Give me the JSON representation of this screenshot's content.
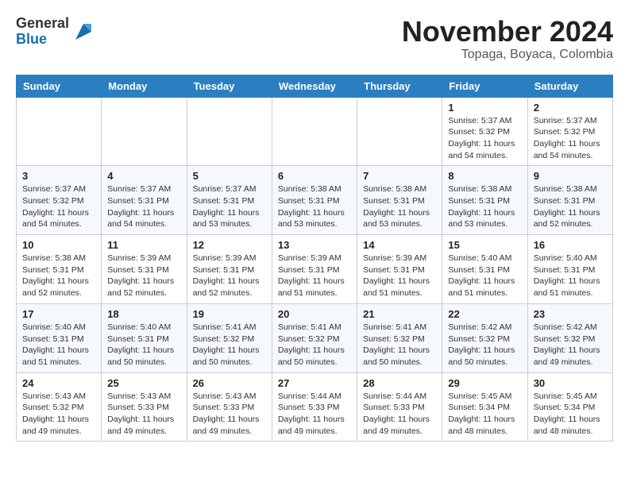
{
  "logo": {
    "general": "General",
    "blue": "Blue"
  },
  "header": {
    "title": "November 2024",
    "subtitle": "Topaga, Boyaca, Colombia"
  },
  "days_of_week": [
    "Sunday",
    "Monday",
    "Tuesday",
    "Wednesday",
    "Thursday",
    "Friday",
    "Saturday"
  ],
  "weeks": [
    [
      {
        "day": "",
        "sunrise": "",
        "sunset": "",
        "daylight": ""
      },
      {
        "day": "",
        "sunrise": "",
        "sunset": "",
        "daylight": ""
      },
      {
        "day": "",
        "sunrise": "",
        "sunset": "",
        "daylight": ""
      },
      {
        "day": "",
        "sunrise": "",
        "sunset": "",
        "daylight": ""
      },
      {
        "day": "",
        "sunrise": "",
        "sunset": "",
        "daylight": ""
      },
      {
        "day": "1",
        "sunrise": "Sunrise: 5:37 AM",
        "sunset": "Sunset: 5:32 PM",
        "daylight": "Daylight: 11 hours and 54 minutes."
      },
      {
        "day": "2",
        "sunrise": "Sunrise: 5:37 AM",
        "sunset": "Sunset: 5:32 PM",
        "daylight": "Daylight: 11 hours and 54 minutes."
      }
    ],
    [
      {
        "day": "3",
        "sunrise": "Sunrise: 5:37 AM",
        "sunset": "Sunset: 5:32 PM",
        "daylight": "Daylight: 11 hours and 54 minutes."
      },
      {
        "day": "4",
        "sunrise": "Sunrise: 5:37 AM",
        "sunset": "Sunset: 5:31 PM",
        "daylight": "Daylight: 11 hours and 54 minutes."
      },
      {
        "day": "5",
        "sunrise": "Sunrise: 5:37 AM",
        "sunset": "Sunset: 5:31 PM",
        "daylight": "Daylight: 11 hours and 53 minutes."
      },
      {
        "day": "6",
        "sunrise": "Sunrise: 5:38 AM",
        "sunset": "Sunset: 5:31 PM",
        "daylight": "Daylight: 11 hours and 53 minutes."
      },
      {
        "day": "7",
        "sunrise": "Sunrise: 5:38 AM",
        "sunset": "Sunset: 5:31 PM",
        "daylight": "Daylight: 11 hours and 53 minutes."
      },
      {
        "day": "8",
        "sunrise": "Sunrise: 5:38 AM",
        "sunset": "Sunset: 5:31 PM",
        "daylight": "Daylight: 11 hours and 53 minutes."
      },
      {
        "day": "9",
        "sunrise": "Sunrise: 5:38 AM",
        "sunset": "Sunset: 5:31 PM",
        "daylight": "Daylight: 11 hours and 52 minutes."
      }
    ],
    [
      {
        "day": "10",
        "sunrise": "Sunrise: 5:38 AM",
        "sunset": "Sunset: 5:31 PM",
        "daylight": "Daylight: 11 hours and 52 minutes."
      },
      {
        "day": "11",
        "sunrise": "Sunrise: 5:39 AM",
        "sunset": "Sunset: 5:31 PM",
        "daylight": "Daylight: 11 hours and 52 minutes."
      },
      {
        "day": "12",
        "sunrise": "Sunrise: 5:39 AM",
        "sunset": "Sunset: 5:31 PM",
        "daylight": "Daylight: 11 hours and 52 minutes."
      },
      {
        "day": "13",
        "sunrise": "Sunrise: 5:39 AM",
        "sunset": "Sunset: 5:31 PM",
        "daylight": "Daylight: 11 hours and 51 minutes."
      },
      {
        "day": "14",
        "sunrise": "Sunrise: 5:39 AM",
        "sunset": "Sunset: 5:31 PM",
        "daylight": "Daylight: 11 hours and 51 minutes."
      },
      {
        "day": "15",
        "sunrise": "Sunrise: 5:40 AM",
        "sunset": "Sunset: 5:31 PM",
        "daylight": "Daylight: 11 hours and 51 minutes."
      },
      {
        "day": "16",
        "sunrise": "Sunrise: 5:40 AM",
        "sunset": "Sunset: 5:31 PM",
        "daylight": "Daylight: 11 hours and 51 minutes."
      }
    ],
    [
      {
        "day": "17",
        "sunrise": "Sunrise: 5:40 AM",
        "sunset": "Sunset: 5:31 PM",
        "daylight": "Daylight: 11 hours and 51 minutes."
      },
      {
        "day": "18",
        "sunrise": "Sunrise: 5:40 AM",
        "sunset": "Sunset: 5:31 PM",
        "daylight": "Daylight: 11 hours and 50 minutes."
      },
      {
        "day": "19",
        "sunrise": "Sunrise: 5:41 AM",
        "sunset": "Sunset: 5:32 PM",
        "daylight": "Daylight: 11 hours and 50 minutes."
      },
      {
        "day": "20",
        "sunrise": "Sunrise: 5:41 AM",
        "sunset": "Sunset: 5:32 PM",
        "daylight": "Daylight: 11 hours and 50 minutes."
      },
      {
        "day": "21",
        "sunrise": "Sunrise: 5:41 AM",
        "sunset": "Sunset: 5:32 PM",
        "daylight": "Daylight: 11 hours and 50 minutes."
      },
      {
        "day": "22",
        "sunrise": "Sunrise: 5:42 AM",
        "sunset": "Sunset: 5:32 PM",
        "daylight": "Daylight: 11 hours and 50 minutes."
      },
      {
        "day": "23",
        "sunrise": "Sunrise: 5:42 AM",
        "sunset": "Sunset: 5:32 PM",
        "daylight": "Daylight: 11 hours and 49 minutes."
      }
    ],
    [
      {
        "day": "24",
        "sunrise": "Sunrise: 5:43 AM",
        "sunset": "Sunset: 5:32 PM",
        "daylight": "Daylight: 11 hours and 49 minutes."
      },
      {
        "day": "25",
        "sunrise": "Sunrise: 5:43 AM",
        "sunset": "Sunset: 5:33 PM",
        "daylight": "Daylight: 11 hours and 49 minutes."
      },
      {
        "day": "26",
        "sunrise": "Sunrise: 5:43 AM",
        "sunset": "Sunset: 5:33 PM",
        "daylight": "Daylight: 11 hours and 49 minutes."
      },
      {
        "day": "27",
        "sunrise": "Sunrise: 5:44 AM",
        "sunset": "Sunset: 5:33 PM",
        "daylight": "Daylight: 11 hours and 49 minutes."
      },
      {
        "day": "28",
        "sunrise": "Sunrise: 5:44 AM",
        "sunset": "Sunset: 5:33 PM",
        "daylight": "Daylight: 11 hours and 49 minutes."
      },
      {
        "day": "29",
        "sunrise": "Sunrise: 5:45 AM",
        "sunset": "Sunset: 5:34 PM",
        "daylight": "Daylight: 11 hours and 48 minutes."
      },
      {
        "day": "30",
        "sunrise": "Sunrise: 5:45 AM",
        "sunset": "Sunset: 5:34 PM",
        "daylight": "Daylight: 11 hours and 48 minutes."
      }
    ]
  ]
}
